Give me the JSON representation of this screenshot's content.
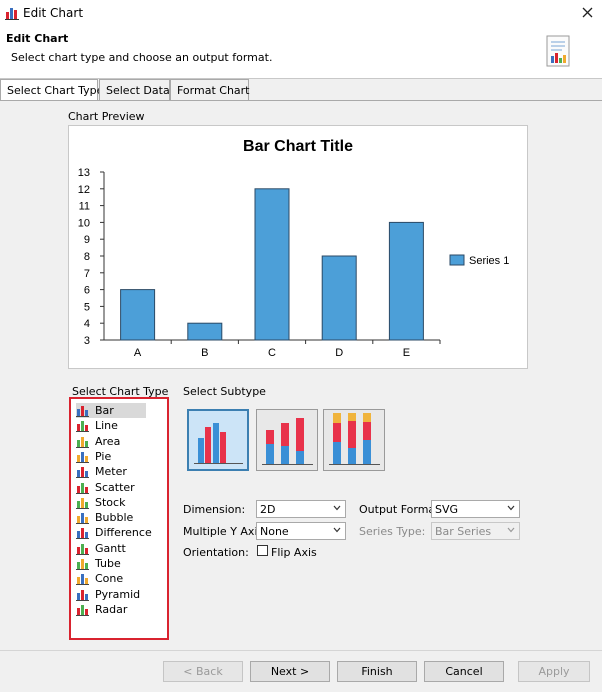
{
  "window": {
    "title": "Edit Chart"
  },
  "header": {
    "title": "Edit Chart",
    "subtitle": "Select chart type and choose an output format."
  },
  "tabs": [
    {
      "label": "Select Chart Type"
    },
    {
      "label": "Select Data"
    },
    {
      "label": "Format Chart"
    }
  ],
  "preview": {
    "label": "Chart Preview",
    "chart_data": {
      "type": "bar",
      "title": "Bar Chart Title",
      "categories": [
        "A",
        "B",
        "C",
        "D",
        "E"
      ],
      "series": [
        {
          "name": "Series 1",
          "values": [
            6,
            4,
            12,
            8,
            10
          ],
          "color": "#4c9fd8"
        }
      ],
      "ylim": [
        3,
        13
      ],
      "yticks": [
        "3",
        "4",
        "5",
        "6",
        "7",
        "8",
        "9",
        "10",
        "11",
        "12",
        "13"
      ],
      "legend": "right"
    }
  },
  "chart_types": {
    "label": "Select Chart Type",
    "selected": "Bar",
    "items": [
      "Bar",
      "Line",
      "Area",
      "Pie",
      "Meter",
      "Scatter",
      "Stock",
      "Bubble",
      "Difference",
      "Gantt",
      "Tube",
      "Cone",
      "Pyramid",
      "Radar"
    ]
  },
  "subtype": {
    "label": "Select Subtype"
  },
  "options": {
    "dimension_label": "Dimension:",
    "dimension_value": "2D",
    "output_format_label": "Output Format:",
    "output_format_value": "SVG",
    "multiple_y_axis_label": "Multiple Y Axis:",
    "multiple_y_axis_value": "None",
    "series_type_label": "Series Type:",
    "series_type_value": "Bar Series",
    "orientation_label": "Orientation:",
    "flip_axis_label": "Flip Axis"
  },
  "buttons": {
    "back": "< Back",
    "next": "Next >",
    "finish": "Finish",
    "cancel": "Cancel",
    "apply": "Apply"
  }
}
